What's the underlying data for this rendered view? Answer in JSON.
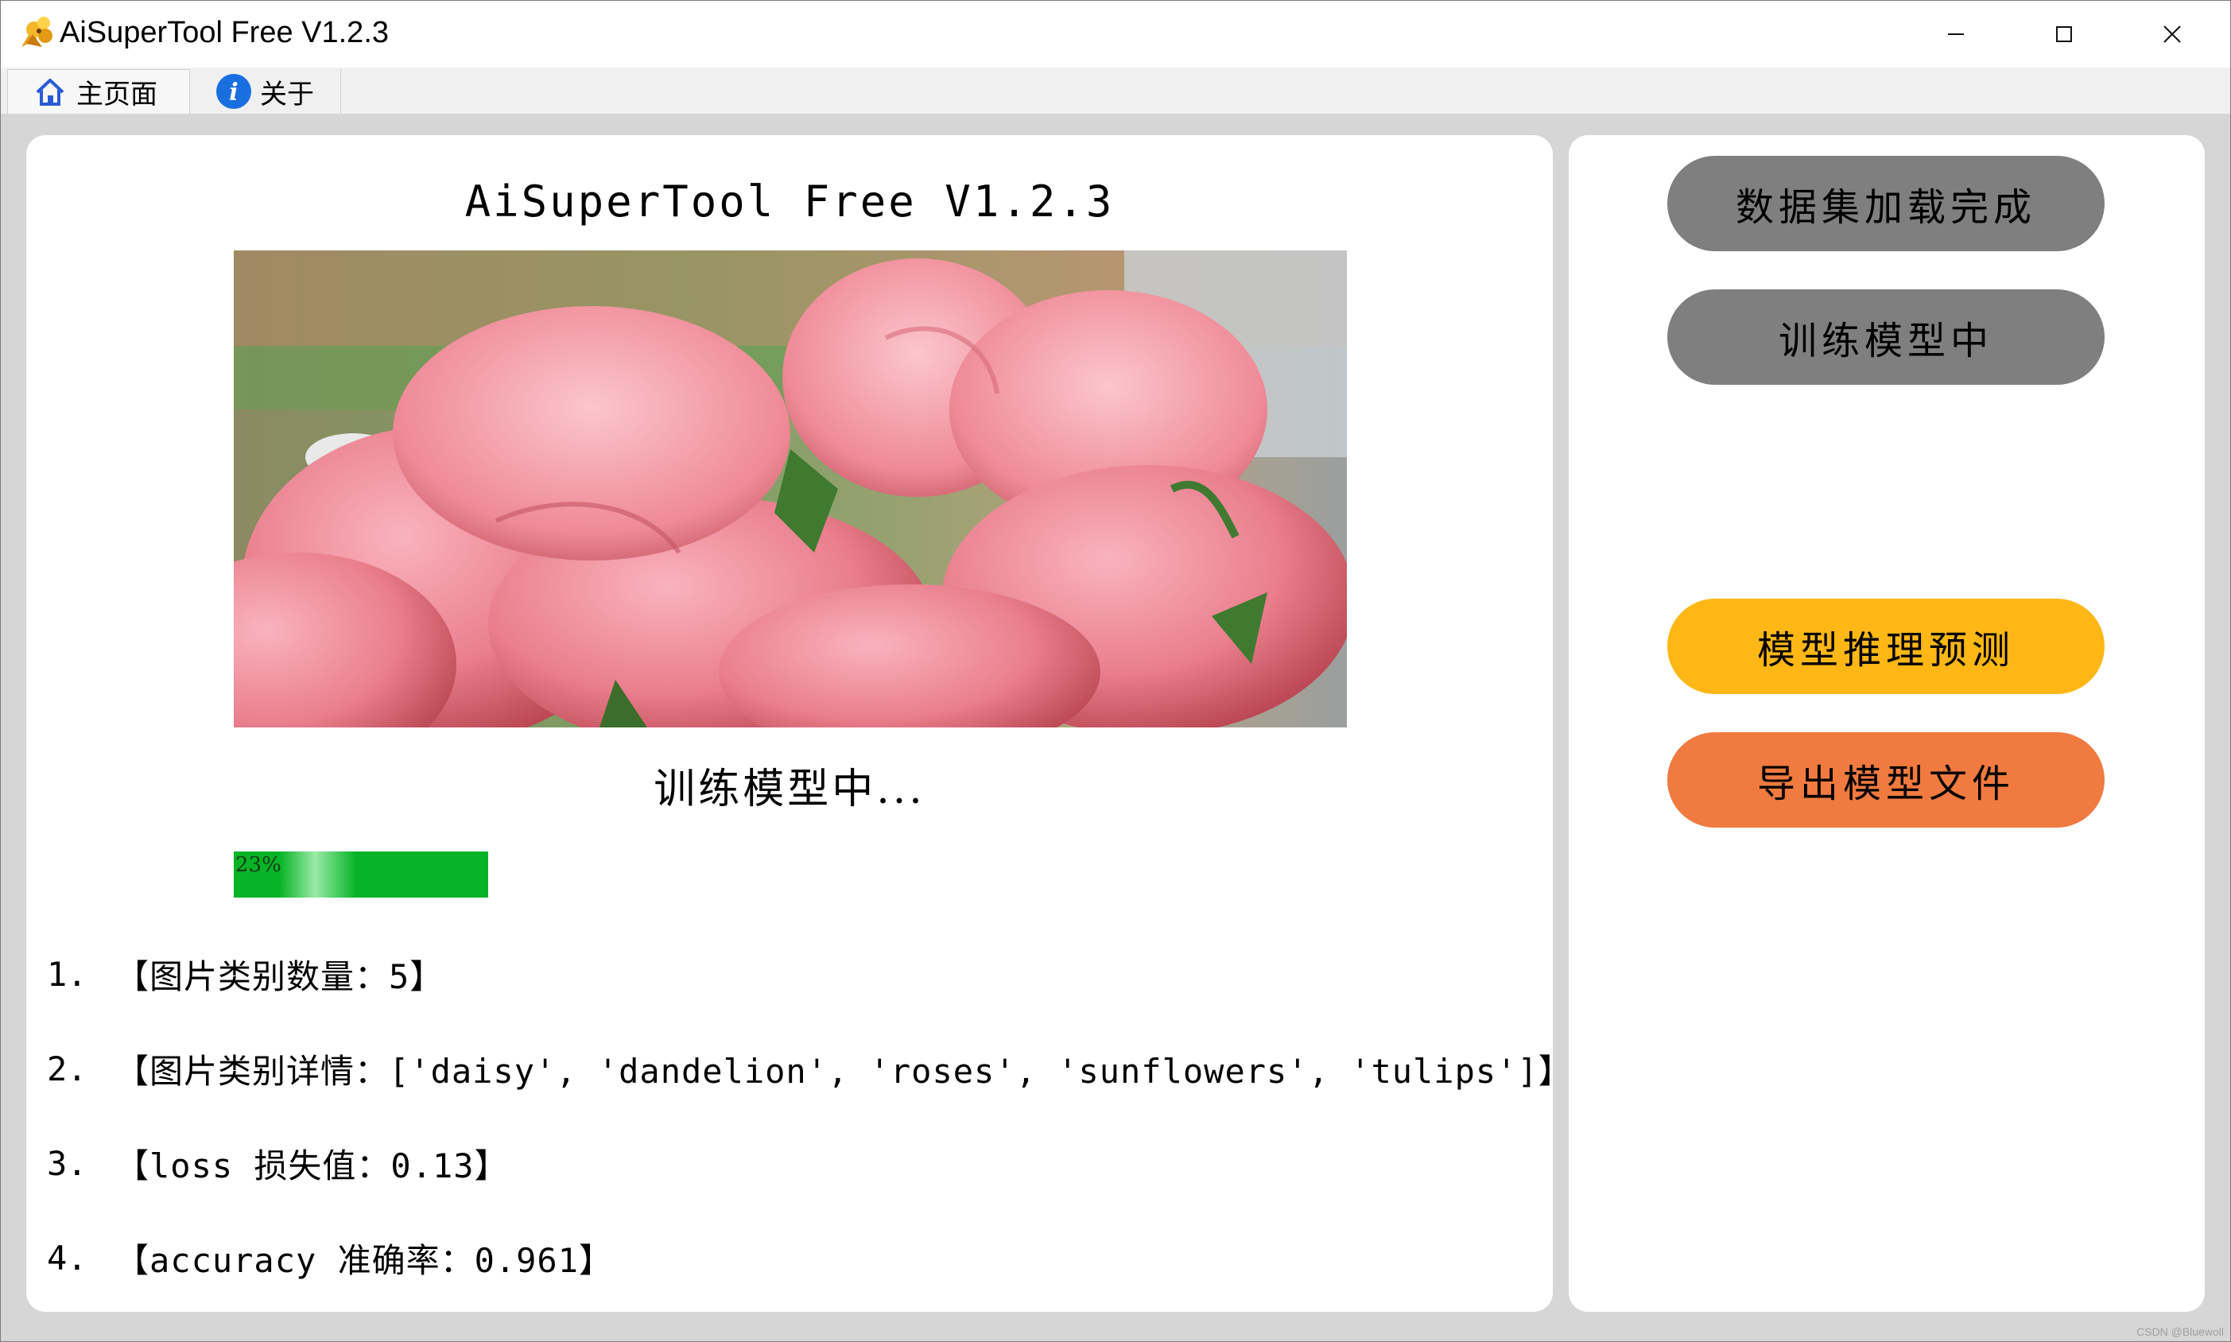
{
  "window": {
    "title": "AiSuperTool Free V1.2.3",
    "controls": {
      "minimize": "minimize-icon",
      "maximize": "maximize-icon",
      "close": "close-icon"
    }
  },
  "tabs": [
    {
      "label": "主页面",
      "icon": "home-icon",
      "selected": true
    },
    {
      "label": "关于",
      "icon": "info-icon",
      "selected": false
    }
  ],
  "main": {
    "title": "AiSuperTool Free V1.2.3",
    "image": "pink-roses-photo",
    "status": "训练模型中...",
    "progress": {
      "label": "23%",
      "value": 0.23,
      "color": "#07b427"
    },
    "info": [
      {
        "num": "1.",
        "text": "【图片类别数量：5】"
      },
      {
        "num": "2.",
        "text": "【图片类别详情：['daisy', 'dandelion', 'roses', 'sunflowers', 'tulips']】"
      },
      {
        "num": "3.",
        "text": "【loss 损失值：0.13】"
      },
      {
        "num": "4.",
        "text": "【accuracy 准确率：0.961】"
      }
    ]
  },
  "sidebar": {
    "buttons": [
      {
        "label": "数据集加载完成",
        "color": "#7f7f7f"
      },
      {
        "label": "训练模型中",
        "color": "#7f7f7f"
      },
      {
        "label": "模型推理预测",
        "color": "#ffb716"
      },
      {
        "label": "导出模型文件",
        "color": "#f07a40"
      }
    ]
  },
  "watermark": "CSDN @Bluewoll"
}
